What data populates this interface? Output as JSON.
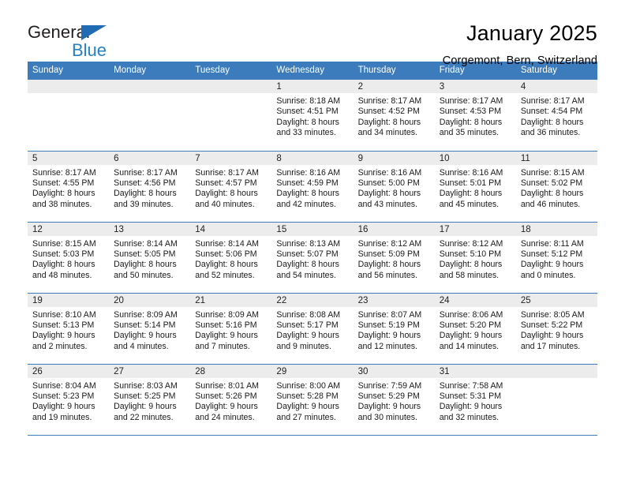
{
  "logo": {
    "word1": "General",
    "word2": "Blue",
    "triangle_color": "#1f6cb4",
    "word2_color": "#2482c5"
  },
  "header": {
    "title": "January 2025",
    "subtitle": "Corgemont, Bern, Switzerland"
  },
  "theme": {
    "header_bg": "#3c7cbd",
    "header_text": "#ffffff",
    "daynum_bg": "#ececec",
    "grid_line": "#3c7cbd"
  },
  "weekday_headers": [
    "Sunday",
    "Monday",
    "Tuesday",
    "Wednesday",
    "Thursday",
    "Friday",
    "Saturday"
  ],
  "weeks": [
    [
      {
        "day": "",
        "sunrise": "",
        "sunset": "",
        "daylight1": "",
        "daylight2": ""
      },
      {
        "day": "",
        "sunrise": "",
        "sunset": "",
        "daylight1": "",
        "daylight2": ""
      },
      {
        "day": "",
        "sunrise": "",
        "sunset": "",
        "daylight1": "",
        "daylight2": ""
      },
      {
        "day": "1",
        "sunrise": "Sunrise: 8:18 AM",
        "sunset": "Sunset: 4:51 PM",
        "daylight1": "Daylight: 8 hours",
        "daylight2": "and 33 minutes."
      },
      {
        "day": "2",
        "sunrise": "Sunrise: 8:17 AM",
        "sunset": "Sunset: 4:52 PM",
        "daylight1": "Daylight: 8 hours",
        "daylight2": "and 34 minutes."
      },
      {
        "day": "3",
        "sunrise": "Sunrise: 8:17 AM",
        "sunset": "Sunset: 4:53 PM",
        "daylight1": "Daylight: 8 hours",
        "daylight2": "and 35 minutes."
      },
      {
        "day": "4",
        "sunrise": "Sunrise: 8:17 AM",
        "sunset": "Sunset: 4:54 PM",
        "daylight1": "Daylight: 8 hours",
        "daylight2": "and 36 minutes."
      }
    ],
    [
      {
        "day": "5",
        "sunrise": "Sunrise: 8:17 AM",
        "sunset": "Sunset: 4:55 PM",
        "daylight1": "Daylight: 8 hours",
        "daylight2": "and 38 minutes."
      },
      {
        "day": "6",
        "sunrise": "Sunrise: 8:17 AM",
        "sunset": "Sunset: 4:56 PM",
        "daylight1": "Daylight: 8 hours",
        "daylight2": "and 39 minutes."
      },
      {
        "day": "7",
        "sunrise": "Sunrise: 8:17 AM",
        "sunset": "Sunset: 4:57 PM",
        "daylight1": "Daylight: 8 hours",
        "daylight2": "and 40 minutes."
      },
      {
        "day": "8",
        "sunrise": "Sunrise: 8:16 AM",
        "sunset": "Sunset: 4:59 PM",
        "daylight1": "Daylight: 8 hours",
        "daylight2": "and 42 minutes."
      },
      {
        "day": "9",
        "sunrise": "Sunrise: 8:16 AM",
        "sunset": "Sunset: 5:00 PM",
        "daylight1": "Daylight: 8 hours",
        "daylight2": "and 43 minutes."
      },
      {
        "day": "10",
        "sunrise": "Sunrise: 8:16 AM",
        "sunset": "Sunset: 5:01 PM",
        "daylight1": "Daylight: 8 hours",
        "daylight2": "and 45 minutes."
      },
      {
        "day": "11",
        "sunrise": "Sunrise: 8:15 AM",
        "sunset": "Sunset: 5:02 PM",
        "daylight1": "Daylight: 8 hours",
        "daylight2": "and 46 minutes."
      }
    ],
    [
      {
        "day": "12",
        "sunrise": "Sunrise: 8:15 AM",
        "sunset": "Sunset: 5:03 PM",
        "daylight1": "Daylight: 8 hours",
        "daylight2": "and 48 minutes."
      },
      {
        "day": "13",
        "sunrise": "Sunrise: 8:14 AM",
        "sunset": "Sunset: 5:05 PM",
        "daylight1": "Daylight: 8 hours",
        "daylight2": "and 50 minutes."
      },
      {
        "day": "14",
        "sunrise": "Sunrise: 8:14 AM",
        "sunset": "Sunset: 5:06 PM",
        "daylight1": "Daylight: 8 hours",
        "daylight2": "and 52 minutes."
      },
      {
        "day": "15",
        "sunrise": "Sunrise: 8:13 AM",
        "sunset": "Sunset: 5:07 PM",
        "daylight1": "Daylight: 8 hours",
        "daylight2": "and 54 minutes."
      },
      {
        "day": "16",
        "sunrise": "Sunrise: 8:12 AM",
        "sunset": "Sunset: 5:09 PM",
        "daylight1": "Daylight: 8 hours",
        "daylight2": "and 56 minutes."
      },
      {
        "day": "17",
        "sunrise": "Sunrise: 8:12 AM",
        "sunset": "Sunset: 5:10 PM",
        "daylight1": "Daylight: 8 hours",
        "daylight2": "and 58 minutes."
      },
      {
        "day": "18",
        "sunrise": "Sunrise: 8:11 AM",
        "sunset": "Sunset: 5:12 PM",
        "daylight1": "Daylight: 9 hours",
        "daylight2": "and 0 minutes."
      }
    ],
    [
      {
        "day": "19",
        "sunrise": "Sunrise: 8:10 AM",
        "sunset": "Sunset: 5:13 PM",
        "daylight1": "Daylight: 9 hours",
        "daylight2": "and 2 minutes."
      },
      {
        "day": "20",
        "sunrise": "Sunrise: 8:09 AM",
        "sunset": "Sunset: 5:14 PM",
        "daylight1": "Daylight: 9 hours",
        "daylight2": "and 4 minutes."
      },
      {
        "day": "21",
        "sunrise": "Sunrise: 8:09 AM",
        "sunset": "Sunset: 5:16 PM",
        "daylight1": "Daylight: 9 hours",
        "daylight2": "and 7 minutes."
      },
      {
        "day": "22",
        "sunrise": "Sunrise: 8:08 AM",
        "sunset": "Sunset: 5:17 PM",
        "daylight1": "Daylight: 9 hours",
        "daylight2": "and 9 minutes."
      },
      {
        "day": "23",
        "sunrise": "Sunrise: 8:07 AM",
        "sunset": "Sunset: 5:19 PM",
        "daylight1": "Daylight: 9 hours",
        "daylight2": "and 12 minutes."
      },
      {
        "day": "24",
        "sunrise": "Sunrise: 8:06 AM",
        "sunset": "Sunset: 5:20 PM",
        "daylight1": "Daylight: 9 hours",
        "daylight2": "and 14 minutes."
      },
      {
        "day": "25",
        "sunrise": "Sunrise: 8:05 AM",
        "sunset": "Sunset: 5:22 PM",
        "daylight1": "Daylight: 9 hours",
        "daylight2": "and 17 minutes."
      }
    ],
    [
      {
        "day": "26",
        "sunrise": "Sunrise: 8:04 AM",
        "sunset": "Sunset: 5:23 PM",
        "daylight1": "Daylight: 9 hours",
        "daylight2": "and 19 minutes."
      },
      {
        "day": "27",
        "sunrise": "Sunrise: 8:03 AM",
        "sunset": "Sunset: 5:25 PM",
        "daylight1": "Daylight: 9 hours",
        "daylight2": "and 22 minutes."
      },
      {
        "day": "28",
        "sunrise": "Sunrise: 8:01 AM",
        "sunset": "Sunset: 5:26 PM",
        "daylight1": "Daylight: 9 hours",
        "daylight2": "and 24 minutes."
      },
      {
        "day": "29",
        "sunrise": "Sunrise: 8:00 AM",
        "sunset": "Sunset: 5:28 PM",
        "daylight1": "Daylight: 9 hours",
        "daylight2": "and 27 minutes."
      },
      {
        "day": "30",
        "sunrise": "Sunrise: 7:59 AM",
        "sunset": "Sunset: 5:29 PM",
        "daylight1": "Daylight: 9 hours",
        "daylight2": "and 30 minutes."
      },
      {
        "day": "31",
        "sunrise": "Sunrise: 7:58 AM",
        "sunset": "Sunset: 5:31 PM",
        "daylight1": "Daylight: 9 hours",
        "daylight2": "and 32 minutes."
      },
      {
        "day": "",
        "sunrise": "",
        "sunset": "",
        "daylight1": "",
        "daylight2": ""
      }
    ]
  ]
}
